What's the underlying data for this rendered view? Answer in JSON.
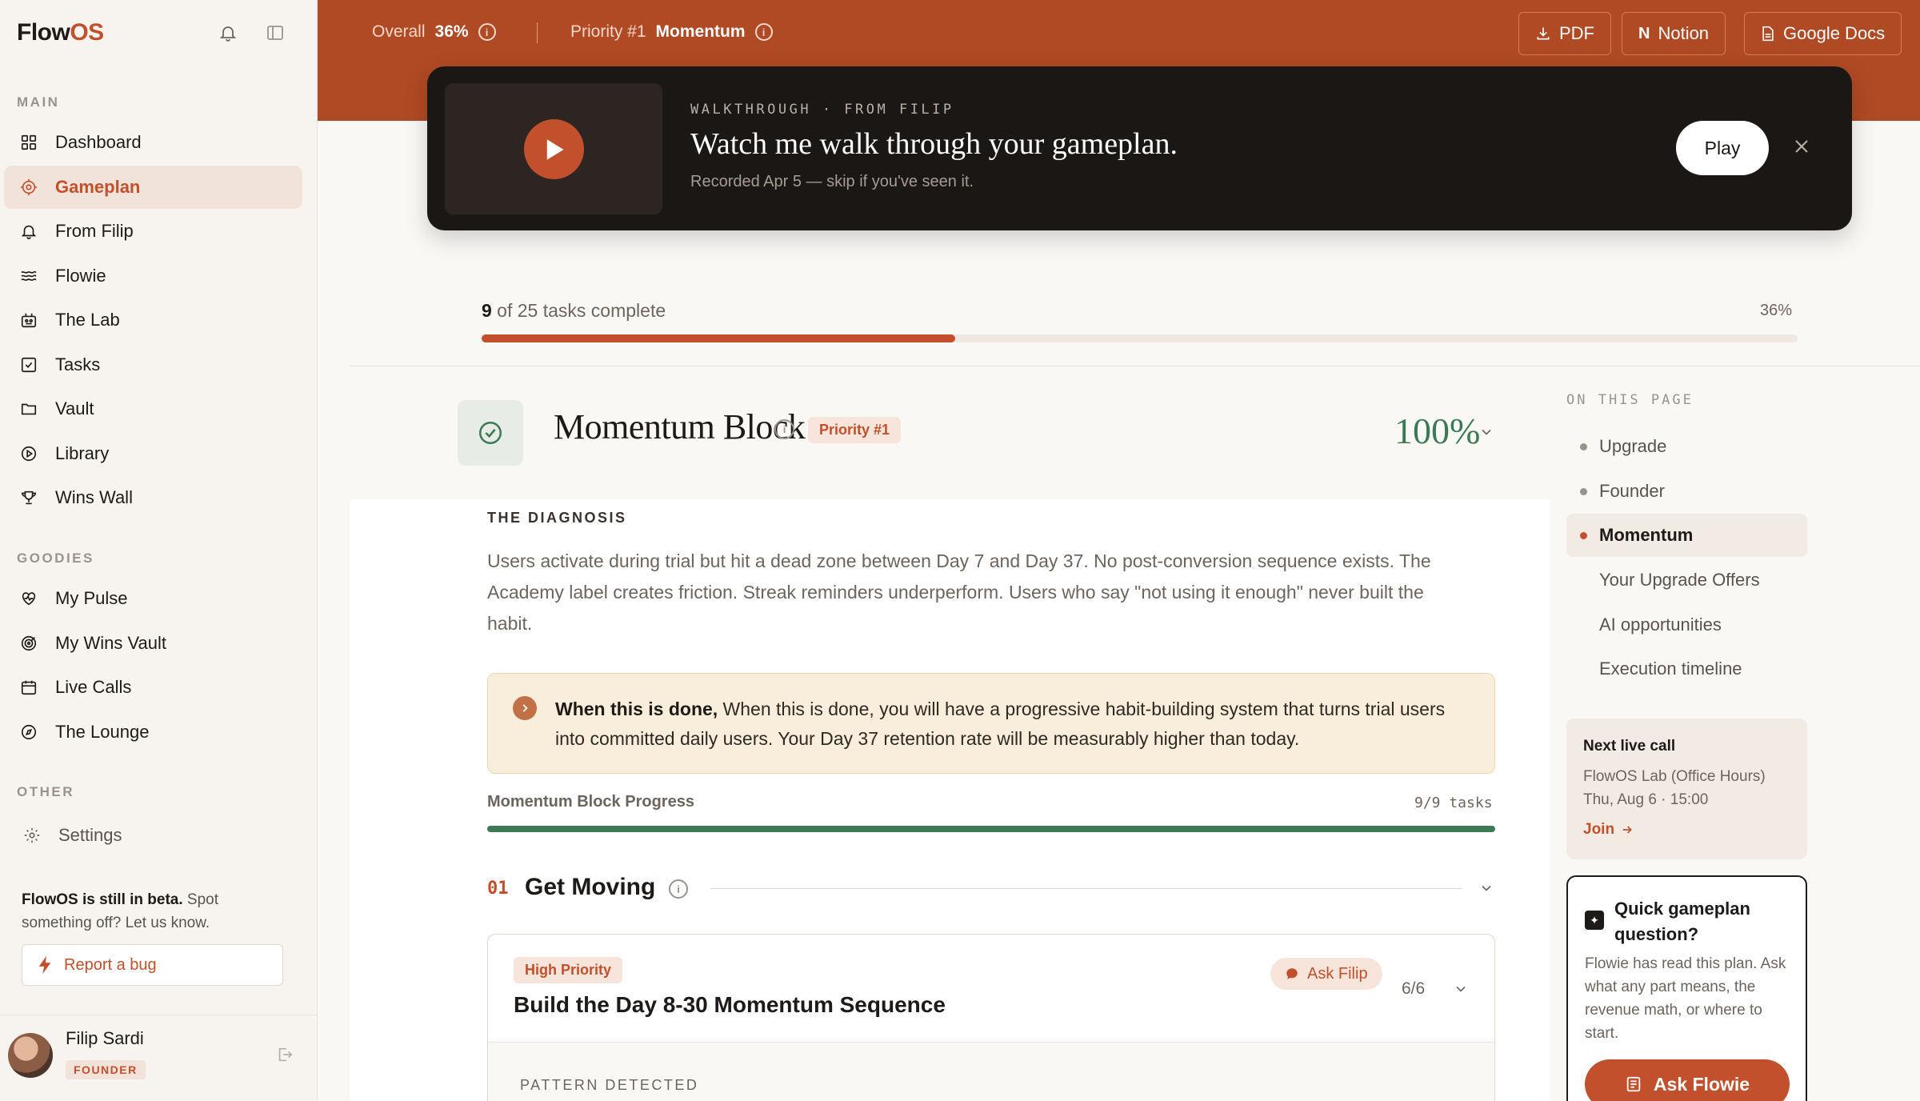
{
  "app": {
    "logo_main": "Flow",
    "logo_accent": "OS"
  },
  "sidebar": {
    "sections": {
      "main": "MAIN",
      "goodies": "GOODIES",
      "other": "OTHER"
    },
    "main_items": [
      {
        "label": "Dashboard",
        "icon": "grid-icon"
      },
      {
        "label": "Gameplan",
        "icon": "target-icon",
        "active": true
      },
      {
        "label": "From Filip",
        "icon": "bell-icon"
      },
      {
        "label": "Flowie",
        "icon": "waves-icon"
      },
      {
        "label": "The Lab",
        "icon": "lab-icon"
      },
      {
        "label": "Tasks",
        "icon": "checkbox-icon"
      },
      {
        "label": "Vault",
        "icon": "folder-icon"
      },
      {
        "label": "Library",
        "icon": "play-circle-icon"
      },
      {
        "label": "Wins Wall",
        "icon": "trophy-icon"
      }
    ],
    "goodies_items": [
      {
        "label": "My Pulse",
        "icon": "heart-pulse-icon"
      },
      {
        "label": "My Wins Vault",
        "icon": "bullseye-icon"
      },
      {
        "label": "Live Calls",
        "icon": "calendar-icon"
      },
      {
        "label": "The Lounge",
        "icon": "compass-icon"
      }
    ],
    "other_items": [
      {
        "label": "Settings",
        "icon": "gear-icon"
      }
    ],
    "beta_bold": "FlowOS is still in beta.",
    "beta_text": " Spot something off? Let us know.",
    "report_bug": "Report a bug",
    "user": {
      "name": "Filip Sardi",
      "badge": "FOUNDER"
    }
  },
  "topbar": {
    "overall_label": "Overall",
    "overall_value": "36%",
    "priority_label": "Priority #1",
    "priority_value": "Momentum",
    "exports": [
      "PDF",
      "Notion",
      "Google Docs"
    ]
  },
  "walkthrough": {
    "kicker": "WALKTHROUGH · FROM FILIP",
    "title": "Watch me walk through your gameplan.",
    "subtitle": "Recorded Apr 5 — skip if you've seen it.",
    "play_label": "Play"
  },
  "progress": {
    "done": "9",
    "rest": " of 25 tasks complete",
    "percent_label": "36%",
    "fraction": 0.36
  },
  "block": {
    "title": "Momentum Block",
    "priority_tag": "Priority #1",
    "percent": "100%",
    "diagnosis_label": "THE DIAGNOSIS",
    "diagnosis_text": "Users activate during trial but hit a dead zone between Day 7 and Day 37. No post-conversion sequence exists. The Academy label creates friction. Streak reminders underperform. Users who say \"not using it enough\" never built the habit.",
    "done_bold": "When this is done,",
    "done_text": " When this is done, you will have a progressive habit-building system that turns trial users into committed daily users. Your Day 37 retention rate will be measurably higher than today.",
    "progress_label": "Momentum Block Progress",
    "progress_count": "9/9 tasks",
    "progress_fraction": 1.0
  },
  "step": {
    "number": "01",
    "title": "Get Moving"
  },
  "task": {
    "tag": "High Priority",
    "title": "Build the Day 8-30 Momentum Sequence",
    "ask_label": "Ask Filip",
    "count": "6/6",
    "pattern_label": "PATTERN DETECTED"
  },
  "on_this_page": {
    "label": "ON THIS PAGE",
    "items": [
      {
        "label": "Upgrade",
        "dot": true
      },
      {
        "label": "Founder",
        "dot": true
      },
      {
        "label": "Momentum",
        "dot": true,
        "active": true
      },
      {
        "label": "Your Upgrade Offers",
        "dot": false
      },
      {
        "label": "AI opportunities",
        "dot": false
      },
      {
        "label": "Execution timeline",
        "dot": false
      }
    ]
  },
  "live_call": {
    "title": "Next live call",
    "name": "FlowOS Lab (Office Hours)",
    "when": "Thu, Aug 6 · 15:00",
    "join": "Join"
  },
  "quick": {
    "title": "Quick gameplan question?",
    "text": "Flowie has read this plan. Ask what any part means, the revenue math, or where to start.",
    "button": "Ask Flowie"
  },
  "colors": {
    "accent": "#c2502c",
    "header": "#b04a25",
    "success": "#3c7a55",
    "dark_card": "#1b1715"
  }
}
